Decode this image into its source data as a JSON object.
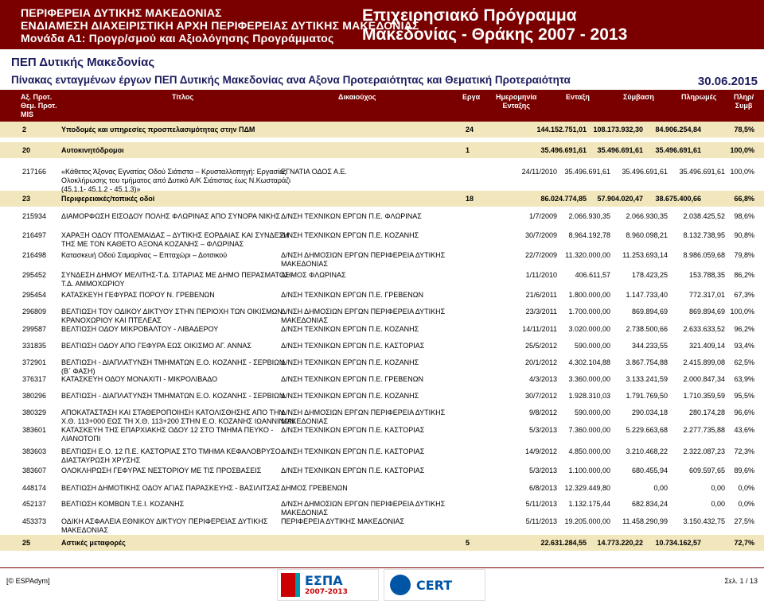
{
  "banner": {
    "left": [
      "ΠΕΡΙΦΕΡΕΙΑ ΔΥΤΙΚΗΣ ΜΑΚΕΔΟΝΙΑΣ",
      "ΕΝΔΙΑΜΕΣΗ ΔΙΑΧΕΙΡΙΣΤΙΚΗ ΑΡΧΗ ΠΕΡΙΦΕΡΕΙΑΣ ΔΥΤΙΚΗΣ ΜΑΚΕΔΟΝΙΑΣ",
      "Μονάδα Α1: Προγρ/σμού και Αξιολόγησης Προγράμματος"
    ],
    "right": [
      "Επιχειρησιακό Πρόγραμμα",
      "Μακεδονίας - Θράκης 2007 - 2013"
    ]
  },
  "title1": "ΠΕΠ Δυτικής Μακεδονίας",
  "title2": "Πίνακας ενταγμένων έργων ΠΕΠ Δυτικής Μακεδονίας ανα Αξονα Προτεραιότητας και Θεματική Προτεραιότητα",
  "date": "30.06.2015",
  "headers": {
    "ax": [
      "Αξ. Προτ.",
      "Θεμ. Προτ.",
      "MIS"
    ],
    "title": "Τίτλος",
    "benef": "Δικαιούχος",
    "erga": "Εργα",
    "datea": [
      "Ημερομηνία",
      "Ενταξης"
    ],
    "entaxi": "Ενταξη",
    "symb": "Σύμβαση",
    "plir": "Πληρωμές",
    "pct": [
      "Πληρ/",
      "Συμβ"
    ]
  },
  "groups": [
    {
      "code": "2",
      "title": "Υποδομές και υπηρεσίες προσπελασιμότητας στην ΠΔΜ",
      "erga": "24",
      "entaxi": "144.152.751,01",
      "symb": "108.173.932,30",
      "plir": "84.906.254,84",
      "pct": "78,5%"
    },
    {
      "code": "20",
      "title": "Αυτοκινητόδρομοι",
      "erga": "1",
      "entaxi": "35.496.691,61",
      "symb": "35.496.691,61",
      "plir": "35.496.691,61",
      "pct": "100,0%"
    },
    {
      "code": "23",
      "title": "Περιφερειακές/τοπικές οδοί",
      "erga": "18",
      "entaxi": "86.024.774,85",
      "symb": "57.904.020,47",
      "plir": "38.675.400,66",
      "pct": "66,8%"
    },
    {
      "code": "25",
      "title": "Αστικές μεταφορές",
      "erga": "5",
      "entaxi": "22.631.284,55",
      "symb": "14.773.220,22",
      "plir": "10.734.162,57",
      "pct": "72,7%"
    }
  ],
  "rows": [
    {
      "mis": "217166",
      "title": [
        "«Κάθετος Άξονας Εγνατίας Οδού Σιάτιστα – Κρυσταλλοπηγή: Εργασίες",
        "Ολοκλήρωσης του τμήματος από Δυτικό Α/Κ Σιάτιστας έως Ν.Κωσταράζι",
        "(45.1.1- 45.1.2 - 45.1.3)»"
      ],
      "benef": [
        "ΕΓΝΑΤΙΑ ΟΔΟΣ Α.Ε."
      ],
      "date": "24/11/2010",
      "entaxi": "35.496.691,61",
      "symb": "35.496.691,61",
      "plir": "35.496.691,61",
      "pct": "100,0%"
    },
    {
      "mis": "215934",
      "title": [
        "ΔΙΑΜΟΡΦΩΣΗ ΕΙΣΟΔΟΥ ΠΟΛΗΣ ΦΛΩΡΙΝΑΣ ΑΠΟ ΣΥΝΟΡΑ ΝΙΚΗΣ"
      ],
      "benef": [
        "Δ/ΝΣΗ ΤΕΧΝΙΚΩΝ ΕΡΓΩΝ Π.Ε. ΦΛΩΡΙΝΑΣ"
      ],
      "date": "1/7/2009",
      "entaxi": "2.066.930,35",
      "symb": "2.066.930,35",
      "plir": "2.038.425,52",
      "pct": "98,6%"
    },
    {
      "mis": "216497",
      "title": [
        "ΧΑΡΑΞΗ ΟΔΟΥ ΠΤΟΛΕΜΑΙΔΑΣ – ΔΥΤΙΚΗΣ ΕΟΡΔΑΙΑΣ ΚΑΙ ΣΥΝΔΕΣΗ",
        "ΤΗΣ ΜΕ ΤΟΝ ΚΑΘΕΤΟ ΑΞΟΝΑ ΚΟΖΑΝΗΣ – ΦΛΩΡΙΝΑΣ"
      ],
      "benef": [
        "Δ/ΝΣΗ ΤΕΧΝΙΚΩΝ ΕΡΓΩΝ Π.Ε. ΚΟΖΑΝΗΣ"
      ],
      "date": "30/7/2009",
      "entaxi": "8.964.192,78",
      "symb": "8.960.098,21",
      "plir": "8.132.738,95",
      "pct": "90,8%"
    },
    {
      "mis": "216498",
      "title": [
        "Κατασκευή Οδού Σαμαρίνας – Επταχώρι – Δοτσικού"
      ],
      "benef": [
        "Δ/ΝΣΗ ΔΗΜΟΣΙΩΝ ΕΡΓΩΝ ΠΕΡΙΦΕΡΕΙΑ ΔΥΤΙΚΗΣ",
        "ΜΑΚΕΔΟΝΙΑΣ"
      ],
      "date": "22/7/2009",
      "entaxi": "11.320.000,00",
      "symb": "11.253.693,14",
      "plir": "8.986.059,68",
      "pct": "79,8%"
    },
    {
      "mis": "295452",
      "title": [
        "ΣΥΝΔΕΣΗ ΔΗΜΟΥ ΜΕΛΙΤΗΣ-Τ.Δ. ΣΙΤΑΡΙΑΣ ΜΕ ΔΗΜΟ ΠΕΡΑΣΜΑΤΟΣ -",
        "Τ.Δ. ΑΜΜΟΧΩΡΙΟΥ"
      ],
      "benef": [
        "ΔΗΜΟΣ ΦΛΩΡΙΝΑΣ"
      ],
      "date": "1/11/2010",
      "entaxi": "406.611,57",
      "symb": "178.423,25",
      "plir": "153.788,35",
      "pct": "86,2%"
    },
    {
      "mis": "295454",
      "title": [
        "ΚΑΤΑΣΚΕΥΗ ΓΕΦΥΡΑΣ ΠΟΡΟΥ Ν. ΓΡΕΒΕΝΩΝ"
      ],
      "benef": [
        "Δ/ΝΣΗ ΤΕΧΝΙΚΩΝ ΕΡΓΩΝ Π.Ε. ΓΡΕΒΕΝΩΝ"
      ],
      "date": "21/6/2011",
      "entaxi": "1.800.000,00",
      "symb": "1.147.733,40",
      "plir": "772.317,01",
      "pct": "67,3%"
    },
    {
      "mis": "296809",
      "title": [
        "ΒΕΛΤΙΩΣΗ ΤΟΥ ΟΔΙΚΟΥ ΔΙΚΤΥΟΥ ΣΤΗΝ ΠΕΡΙΟΧΗ ΤΩΝ ΟΙΚΙΣΜΩΝ",
        "ΚΡΑΝΟΧΩΡΙΟΥ ΚΑΙ ΠΤΕΛΕΑΣ"
      ],
      "benef": [
        "Δ/ΝΣΗ ΔΗΜΟΣΙΩΝ ΕΡΓΩΝ ΠΕΡΙΦΕΡΕΙΑ ΔΥΤΙΚΗΣ",
        "ΜΑΚΕΔΟΝΙΑΣ"
      ],
      "date": "23/3/2011",
      "entaxi": "1.700.000,00",
      "symb": "869.894,69",
      "plir": "869.894,69",
      "pct": "100,0%"
    },
    {
      "mis": "299587",
      "title": [
        "ΒΕΛΤΙΩΣΗ ΟΔΟΥ ΜΙΚΡΟΒΑΛΤΟΥ - ΛΙΒΑΔΕΡΟΥ"
      ],
      "benef": [
        "Δ/ΝΣΗ ΤΕΧΝΙΚΩΝ ΕΡΓΩΝ Π.Ε. ΚΟΖΑΝΗΣ"
      ],
      "date": "14/11/2011",
      "entaxi": "3.020.000,00",
      "symb": "2.738.500,66",
      "plir": "2.633.633,52",
      "pct": "96,2%"
    },
    {
      "mis": "331835",
      "title": [
        "ΒΕΛΤΙΩΣΗ ΟΔΟΥ ΑΠΟ ΓΕΦΥΡΑ ΕΩΣ ΟΙΚΙΣΜΟ ΑΓ. ΑΝΝΑΣ"
      ],
      "benef": [
        "Δ/ΝΣΗ ΤΕΧΝΙΚΩΝ ΕΡΓΩΝ Π.Ε. ΚΑΣΤΟΡΙΑΣ"
      ],
      "date": "25/5/2012",
      "entaxi": "590.000,00",
      "symb": "344.233,55",
      "plir": "321.409,14",
      "pct": "93,4%"
    },
    {
      "mis": "372901",
      "title": [
        "ΒΕΛΤΙΩΣΗ - ΔΙΑΠΛΑΤΥΝΣΗ ΤΜΗΜΑΤΩΝ Ε.Ο. ΚΟΖΑΝΗΣ - ΣΕΡΒΙΩΝ",
        "(Β΄ ΦΑΣΗ)"
      ],
      "benef": [
        "Δ/ΝΣΗ ΤΕΧΝΙΚΩΝ ΕΡΓΩΝ Π.Ε. ΚΟΖΑΝΗΣ"
      ],
      "date": "20/1/2012",
      "entaxi": "4.302.104,88",
      "symb": "3.867.754,88",
      "plir": "2.415.899,08",
      "pct": "62,5%"
    },
    {
      "mis": "376317",
      "title": [
        "ΚΑΤΑΣΚΕΥΗ ΟΔΟΥ ΜΟΝΑΧΙΤΙ - ΜΙΚΡΟΛΙΒΑΔΟ"
      ],
      "benef": [
        "Δ/ΝΣΗ ΤΕΧΝΙΚΩΝ ΕΡΓΩΝ Π.Ε. ΓΡΕΒΕΝΩΝ"
      ],
      "date": "4/3/2013",
      "entaxi": "3.360.000,00",
      "symb": "3.133.241,59",
      "plir": "2.000.847,34",
      "pct": "63,9%"
    },
    {
      "mis": "380296",
      "title": [
        "ΒΕΛΤΙΩΣΗ - ΔΙΑΠΛΑΤΥΝΣΗ ΤΜΗΜΑΤΩΝ Ε.Ο. ΚΟΖΑΝΗΣ - ΣΕΡΒΙΩΝ"
      ],
      "benef": [
        "Δ/ΝΣΗ ΤΕΧΝΙΚΩΝ ΕΡΓΩΝ Π.Ε. ΚΟΖΑΝΗΣ"
      ],
      "date": "30/7/2012",
      "entaxi": "1.928.310,03",
      "symb": "1.791.769,50",
      "plir": "1.710.359,59",
      "pct": "95,5%"
    },
    {
      "mis": "380329",
      "title": [
        "ΑΠΟΚΑΤΑΣΤΑΣΗ ΚΑΙ ΣΤΑΘΕΡΟΠΟΙΗΣΗ ΚΑΤΟΛΙΣΘΗΣΗΣ ΑΠΟ ΤΗΝ",
        "Χ.Θ. 113+000 ΕΩΣ ΤΗ Χ.Θ. 113+200 ΣΤΗΝ Ε.Ο. ΚΟΖΑΝΗΣ ΙΩΑΝΝΙΝΩΝ"
      ],
      "benef": [
        "Δ/ΝΣΗ ΔΗΜΟΣΙΩΝ ΕΡΓΩΝ ΠΕΡΙΦΕΡΕΙΑ ΔΥΤΙΚΗΣ",
        "ΜΑΚΕΔΟΝΙΑΣ"
      ],
      "date": "9/8/2012",
      "entaxi": "590.000,00",
      "symb": "290.034,18",
      "plir": "280.174,28",
      "pct": "96,6%"
    },
    {
      "mis": "383601",
      "title": [
        "ΚΑΤΑΣΚΕΥΗ ΤΗΣ ΕΠΑΡΧΙΑΚΗΣ ΟΔΟΥ 12 ΣΤΟ ΤΜΗΜΑ ΠΕΥΚΟ -",
        "ΛΙΑΝΟΤΟΠΙ"
      ],
      "benef": [
        "Δ/ΝΣΗ ΤΕΧΝΙΚΩΝ ΕΡΓΩΝ Π.Ε. ΚΑΣΤΟΡΙΑΣ"
      ],
      "date": "5/3/2013",
      "entaxi": "7.360.000,00",
      "symb": "5.229.663,68",
      "plir": "2.277.735,88",
      "pct": "43,6%"
    },
    {
      "mis": "383603",
      "title": [
        "ΒΕΛΤΙΩΣΗ Ε.Ο. 12 Π.Ε. ΚΑΣΤΟΡΙΑΣ ΣΤΟ ΤΜΗΜΑ ΚΕΦΑΛΟΒΡΥΣΟ -",
        "ΔΙΑΣΤΑΥΡΩΣΗ ΧΡΥΣΗΣ"
      ],
      "benef": [
        "Δ/ΝΣΗ ΤΕΧΝΙΚΩΝ ΕΡΓΩΝ Π.Ε. ΚΑΣΤΟΡΙΑΣ"
      ],
      "date": "14/9/2012",
      "entaxi": "4.850.000,00",
      "symb": "3.210.468,22",
      "plir": "2.322.087,23",
      "pct": "72,3%"
    },
    {
      "mis": "383607",
      "title": [
        "ΟΛΟΚΛΗΡΩΣΗ ΓΕΦΥΡΑΣ ΝΕΣΤΟΡΙΟΥ ΜΕ ΤΙΣ ΠΡΟΣΒΑΣΕΙΣ"
      ],
      "benef": [
        "Δ/ΝΣΗ ΤΕΧΝΙΚΩΝ ΕΡΓΩΝ Π.Ε. ΚΑΣΤΟΡΙΑΣ"
      ],
      "date": "5/3/2013",
      "entaxi": "1.100.000,00",
      "symb": "680.455,94",
      "plir": "609.597,65",
      "pct": "89,6%"
    },
    {
      "mis": "448174",
      "title": [
        "ΒΕΛΤΙΩΣΗ ΔΗΜΟΤΙΚΗΣ ΟΔΟΥ ΑΓΙΑΣ ΠΑΡΑΣΚΕΥΗΣ - ΒΑΣΙΛΙΤΣΑΣ"
      ],
      "benef": [
        "ΔΗΜΟΣ ΓΡΕΒΕΝΩΝ"
      ],
      "date": "6/8/2013",
      "entaxi": "12.329.449,80",
      "symb": "0,00",
      "plir": "0,00",
      "pct": "0,0%"
    },
    {
      "mis": "452137",
      "title": [
        "ΒΕΛΤΙΩΣΗ ΚΟΜΒΩΝ Τ.Ε.Ι. ΚΟΖΑΝΗΣ"
      ],
      "benef": [
        "Δ/ΝΣΗ ΔΗΜΟΣΙΩΝ ΕΡΓΩΝ ΠΕΡΙΦΕΡΕΙΑ ΔΥΤΙΚΗΣ",
        "ΜΑΚΕΔΟΝΙΑΣ"
      ],
      "date": "5/11/2013",
      "entaxi": "1.132.175,44",
      "symb": "682.834,24",
      "plir": "0,00",
      "pct": "0,0%"
    },
    {
      "mis": "453373",
      "title": [
        "ΟΔΙΚΗ ΑΣΦΑΛΕΙΑ ΕΘΝΙΚΟΥ ΔΙΚΤΥΟΥ ΠΕΡΙΦΕΡΕΙΑΣ ΔΥΤΙΚΗΣ",
        "ΜΑΚΕΔΟΝΙΑΣ"
      ],
      "benef": [
        "ΠΕΡΙΦΕΡΕΙΑ ΔΥΤΙΚΗΣ ΜΑΚΕΔΟΝΙΑΣ"
      ],
      "date": "5/11/2013",
      "entaxi": "19.205.000,00",
      "symb": "11.458.290,99",
      "plir": "3.150.432,75",
      "pct": "27,5%"
    }
  ],
  "footer": {
    "left": "[© ESPAdym]",
    "right": "Σελ. 1 / 13"
  },
  "logos": {
    "espa_text": "ΕΣΠΑ",
    "espa_years": "2007-2013",
    "cert_text": "CERT"
  }
}
